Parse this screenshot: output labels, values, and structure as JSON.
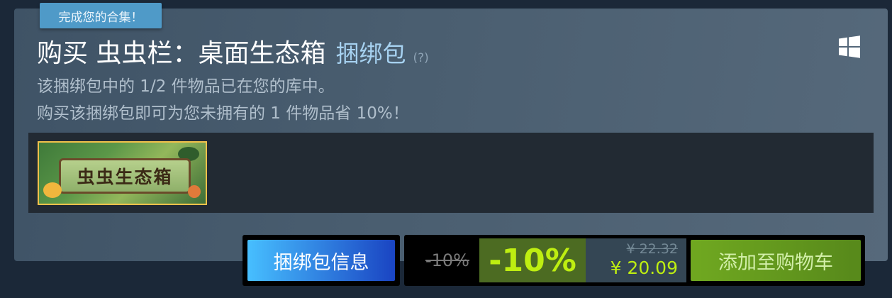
{
  "badge": {
    "text": "完成您的合集！"
  },
  "header": {
    "title": "购买 虫虫栏：桌面生态箱",
    "bundle_tag": "捆绑包",
    "help": "(?)"
  },
  "description": {
    "line1": "该捆绑包中的 1/2 件物品已在您的库中。",
    "line2": "购买该捆绑包即可为您未拥有的 1 件物品省 10%！"
  },
  "platform": {
    "icon": "windows-icon"
  },
  "items": [
    {
      "capsule_text": "虫虫生态箱"
    }
  ],
  "actions": {
    "info_button": "捆绑包信息",
    "original_discount": "-10%",
    "discount": "-10%",
    "original_price": "¥ 22.32",
    "final_price": "¥ 20.09",
    "cart_button": "添加至购物车"
  },
  "colors": {
    "accent_green": "#beee11",
    "discount_bg": "#4c6b22",
    "info_button": "#47bfff"
  }
}
